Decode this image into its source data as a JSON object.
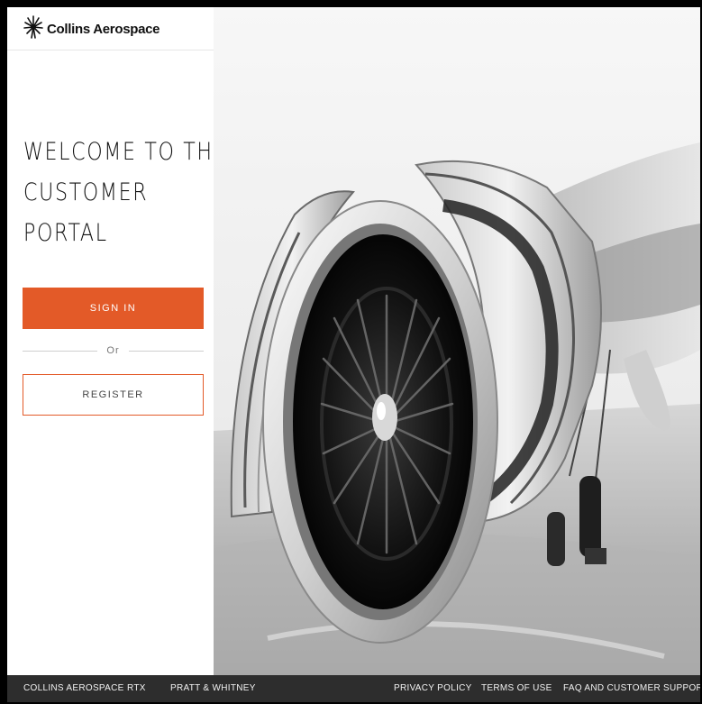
{
  "brand": {
    "logo_text": "Collins Aerospace",
    "logo_icon": "collins-starburst-icon"
  },
  "welcome": {
    "lines": [
      "WELCOME TO THE",
      "CUSTOMER",
      "PORTAL"
    ]
  },
  "auth": {
    "signin_label": "SIGN IN",
    "or_label": "Or",
    "register_label": "REGISTER"
  },
  "hero": {
    "image": "jet-engine-photo"
  },
  "footer": {
    "links": [
      "COLLINS AEROSPACE",
      "RTX",
      "PRATT & WHITNEY",
      "PRIVACY POLICY",
      "TERMS OF USE",
      "FAQ AND CUSTOMER SUPPORT"
    ]
  },
  "colors": {
    "accent": "#e35a28",
    "footer_bg": "#2d2d2d",
    "text": "#111111"
  }
}
